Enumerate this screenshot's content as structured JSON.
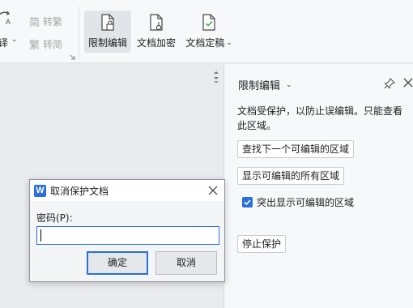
{
  "ribbon": {
    "translate_partial": "译",
    "traditional_label": "转繁",
    "simplified_label": "转简",
    "restrict_edit_label": "限制编辑",
    "encrypt_label": "文档加密",
    "finalize_label": "文档定稿",
    "simplified_icon_glyph": "简",
    "traditional_icon_glyph": "繁"
  },
  "pane": {
    "title": "限制编辑",
    "description": "文档受保护，以防止误编辑。只能查看此区域。",
    "find_next_label": "查找下一个可编辑的区域",
    "show_all_label": "显示可编辑的所有区域",
    "highlight_label": "突出显示可编辑的区域",
    "highlight_checked": true,
    "stop_protect_label": "停止保护"
  },
  "dialog": {
    "logo_letter": "W",
    "title": "取消保护文档",
    "password_label": "密码(P):",
    "password_value": "",
    "ok_label": "确定",
    "cancel_label": "取消"
  },
  "colors": {
    "accent": "#2b6fdc",
    "ribbon_bg": "#f7f8fa",
    "doc_bg": "#e9ebee"
  }
}
